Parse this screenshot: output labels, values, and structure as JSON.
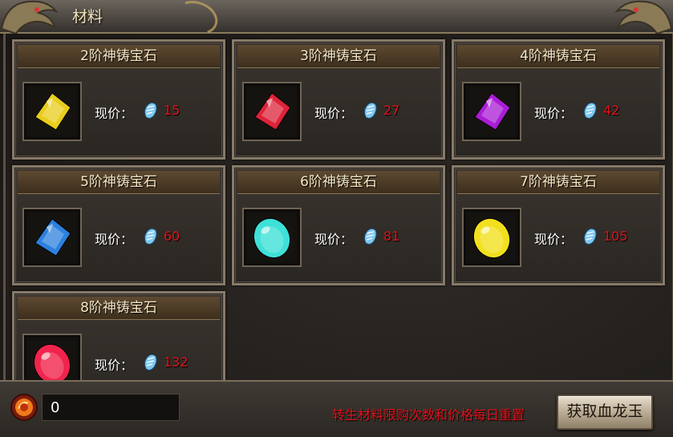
{
  "header": {
    "title": "材料"
  },
  "price_label": "现价：",
  "gems": [
    {
      "name": "2阶神铸宝石",
      "price": "15",
      "color": "#f4d81c",
      "shape": "diamond"
    },
    {
      "name": "3阶神铸宝石",
      "price": "27",
      "color": "#e8243c",
      "shape": "diamond"
    },
    {
      "name": "4阶神铸宝石",
      "price": "42",
      "color": "#b21ee0",
      "shape": "diamond"
    },
    {
      "name": "5阶神铸宝石",
      "price": "60",
      "color": "#2f86e8",
      "shape": "diamond"
    },
    {
      "name": "6阶神铸宝石",
      "price": "81",
      "color": "#3fe0d8",
      "shape": "oval"
    },
    {
      "name": "7阶神铸宝石",
      "price": "105",
      "color": "#f2e01e",
      "shape": "oval"
    },
    {
      "name": "8阶神铸宝石",
      "price": "132",
      "color": "#f0244c",
      "shape": "oval"
    }
  ],
  "footer": {
    "currency_value": "0",
    "notice": "转生材料限购次数和价格每日重置",
    "get_button_label": "获取血龙玉"
  },
  "colors": {
    "price": "#e0131b",
    "card_border": "#867a69",
    "title_bg": "#4a3924"
  }
}
